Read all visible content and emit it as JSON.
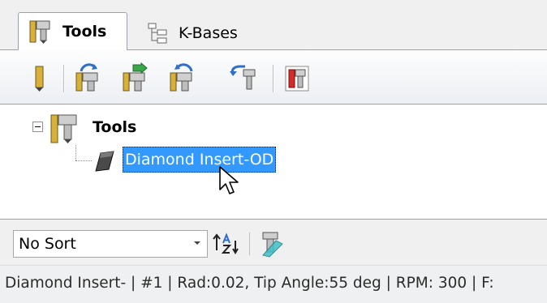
{
  "tabs": [
    {
      "label": "Tools",
      "icon": "tool-holder-icon",
      "active": true
    },
    {
      "label": "K-Bases",
      "icon": "tree-structure-icon",
      "active": false
    }
  ],
  "toolbar": {
    "buttons": [
      {
        "icon": "single-tool-icon"
      },
      {
        "icon": "tool-library-open-icon"
      },
      {
        "icon": "tool-library-import-icon"
      },
      {
        "icon": "tool-library-save-icon"
      },
      {
        "icon": "tool-undo-icon"
      },
      {
        "icon": "tool-report-icon"
      }
    ]
  },
  "tree": {
    "root": {
      "label": "Tools",
      "icon": "tool-holder-icon",
      "expanded": true
    },
    "children": [
      {
        "label": "Diamond Insert-OD",
        "icon": "diamond-insert-icon",
        "selected": true
      }
    ]
  },
  "sort": {
    "selected": "No Sort",
    "sort_icon": "sort-az-icon",
    "filter_icon": "tool-filter-icon"
  },
  "status": {
    "text": "Diamond Insert- | #1 | Rad:0.02, Tip Angle:55 deg | RPM: 300 | F:"
  },
  "colors": {
    "selection": "#3399ff",
    "window_bg": "#f0f0f0",
    "panel_bg": "#ffffff"
  }
}
